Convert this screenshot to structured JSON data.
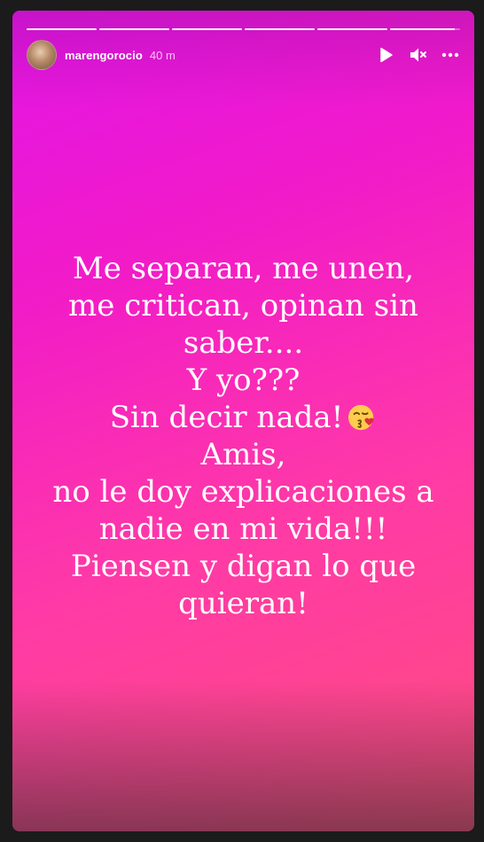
{
  "story": {
    "username": "marengorocio",
    "time_ago": "40 m",
    "progress": {
      "segments": 6,
      "active_index": 5,
      "active_fraction": 0.92
    },
    "controls": [
      {
        "name": "play-icon"
      },
      {
        "name": "muted-icon"
      },
      {
        "name": "more-icon"
      }
    ],
    "caption_lines": [
      "Me separan, me unen,",
      "me critican, opinan sin",
      "saber....",
      "Y yo???",
      "Sin decir nada!",
      "Amis,",
      "no le doy explicaciones a",
      "nadie en mi vida!!!",
      "Piensen y digan lo que",
      "quieran!"
    ],
    "emoji_after_line": 4,
    "emoji": "kissing-face-with-heart-icon",
    "colors": {
      "gradient_top": "#e215e6",
      "gradient_bottom": "#ff4d7d",
      "text": "#ffffff"
    }
  }
}
